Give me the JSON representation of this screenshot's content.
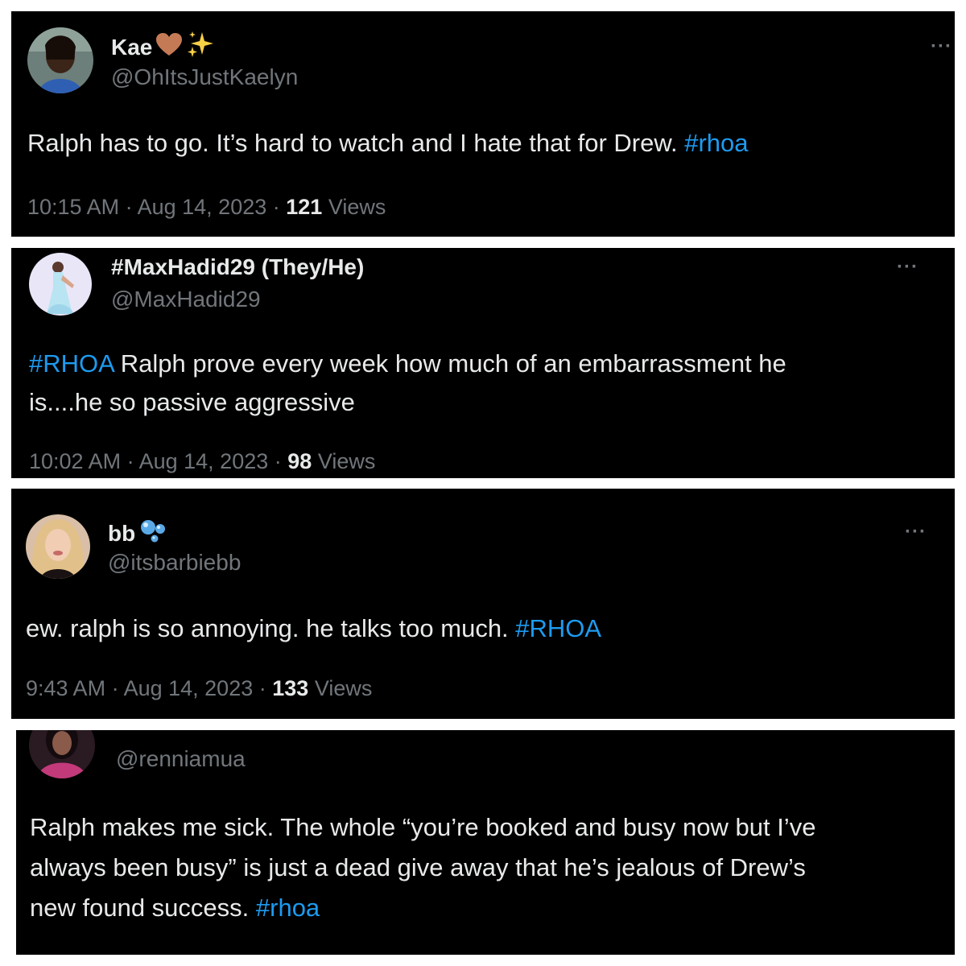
{
  "tweets": [
    {
      "display_name": "Kae",
      "handle": "@OhItsJustKaelyn",
      "avatar_icon": "avatar-woman-sunglasses",
      "badges": [
        "brown-heart-icon",
        "sparkles-icon"
      ],
      "text_before": "Ralph has to go. It’s hard to watch and I hate that for Drew.  ",
      "hashtag": "#rhoa",
      "time": "10:15 AM",
      "date": "Aug 14, 2023",
      "views_count": "121",
      "views_label": "Views",
      "more_label": "···"
    },
    {
      "display_name": "#MaxHadid29 (They/He)",
      "handle": "@MaxHadid29",
      "avatar_icon": "avatar-person-blue-dress",
      "hashtag": "#RHOA",
      "text_line1": " Ralph prove every week how much of an embarrassment he",
      "text_line2": "is....he so passive aggressive",
      "time": "10:02 AM",
      "date": "Aug 14, 2023",
      "views_count": "98",
      "views_label": "Views",
      "more_label": "···"
    },
    {
      "display_name": "bb",
      "handle": "@itsbarbiebb",
      "avatar_icon": "avatar-blonde-woman",
      "badges": [
        "bubbles-icon"
      ],
      "text_before": "ew. ralph is so annoying. he talks too much. ",
      "hashtag": "#RHOA",
      "time": "9:43 AM",
      "date": "Aug 14, 2023",
      "views_count": "133",
      "views_label": "Views",
      "more_label": "···"
    },
    {
      "handle": "@renniamua",
      "avatar_icon": "avatar-dark-hair-pink",
      "text_line1": "Ralph makes me sick. The whole “you’re booked and busy now but I’ve",
      "text_line2": "always been busy” is just a dead give away that he’s jealous of Drew’s",
      "text_line3_before": "new found success. ",
      "hashtag": "#rhoa"
    }
  ],
  "colors": {
    "background": "#000000",
    "text": "#e7e9ea",
    "secondary": "#71767b",
    "hashtag": "#1d9bf0"
  }
}
